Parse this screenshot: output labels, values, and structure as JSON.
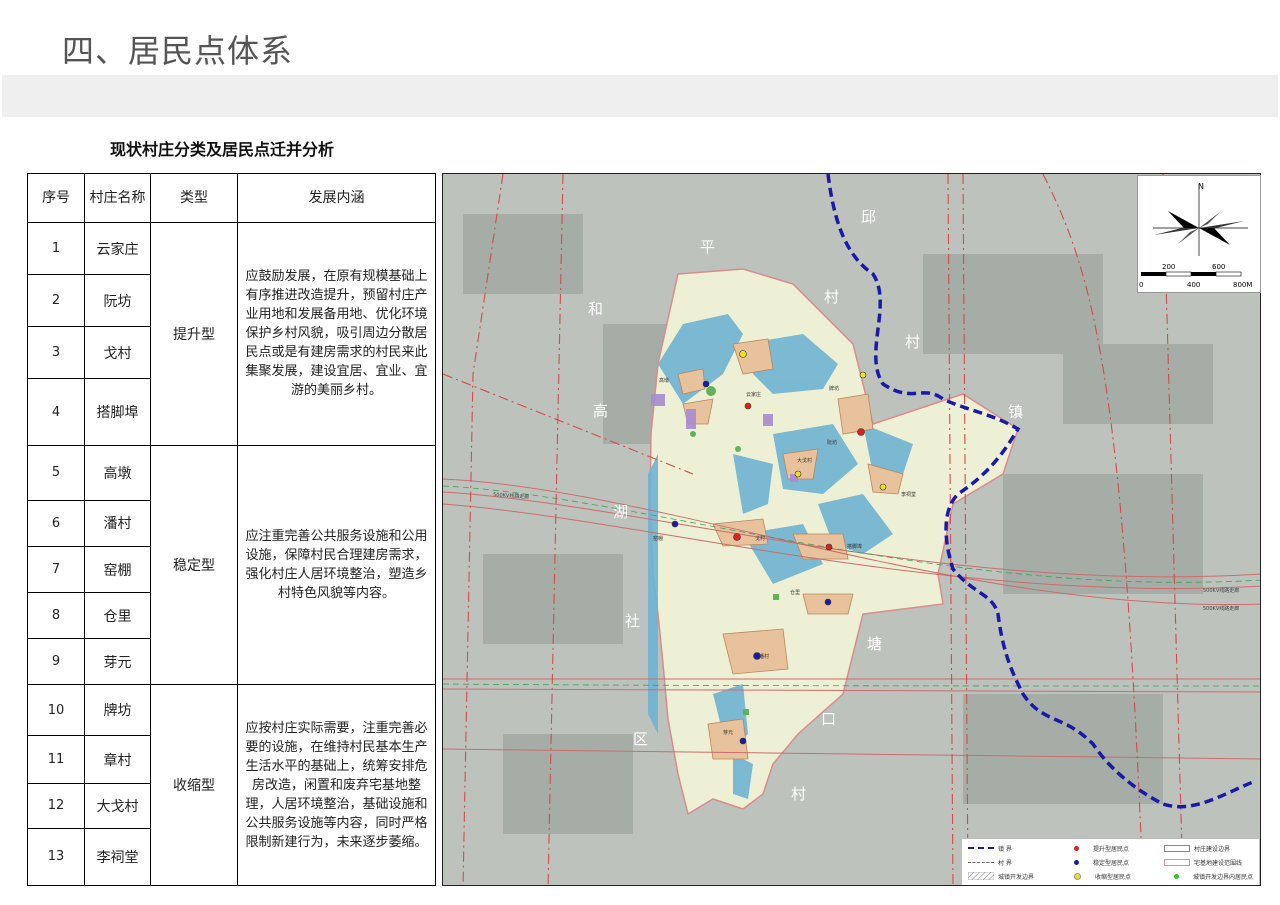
{
  "page": {
    "title": "四、居民点体系",
    "section_title": "现状村庄分类及居民点迁并分析"
  },
  "table": {
    "headers": [
      "序号",
      "村庄名称",
      "类型",
      "发展内涵"
    ],
    "groups": [
      {
        "type": "提升型",
        "description": "应鼓励发展，在原有规模基础上有序推进改造提升，预留村庄产业用地和发展备用地、优化环境保护乡村风貌，吸引周边分散居民点或是有建房需求的村民来此集聚发展，建设宜居、宜业、宜游的美丽乡村。",
        "rows": [
          {
            "num": "1",
            "name": "云家庄"
          },
          {
            "num": "2",
            "name": "阮坊"
          },
          {
            "num": "3",
            "name": "戈村"
          },
          {
            "num": "4",
            "name": "搭脚埠"
          }
        ]
      },
      {
        "type": "稳定型",
        "description": "应注重完善公共服务设施和公用设施，保障村民合理建房需求，强化村庄人居环境整治，塑造乡村特色风貌等内容。",
        "rows": [
          {
            "num": "5",
            "name": "高墩"
          },
          {
            "num": "6",
            "name": "潘村"
          },
          {
            "num": "7",
            "name": "窑棚"
          },
          {
            "num": "8",
            "name": "仓里"
          },
          {
            "num": "9",
            "name": "芽元"
          }
        ]
      },
      {
        "type": "收缩型",
        "description": "应按村庄实际需要，注重完善必要的设施，在维持村民基本生产生活水平的基础上，统筹安排危房改造，闲置和废弃宅基地整理，人居环境整治，基础设施和公共服务设施等内容，同时严格限制新建行为，未来逐步萎缩。",
        "rows": [
          {
            "num": "10",
            "name": "牌坊"
          },
          {
            "num": "11",
            "name": "章村"
          },
          {
            "num": "12",
            "name": "大戈村"
          },
          {
            "num": "13",
            "name": "李祠堂"
          }
        ]
      }
    ]
  },
  "map": {
    "compass_label": "N",
    "scale_top": [
      "200",
      "600"
    ],
    "scale_bottom": [
      "0",
      "400",
      "800M"
    ],
    "region_labels": [
      "邱",
      "平",
      "和",
      "高",
      "湖",
      "社",
      "区",
      "村",
      "村",
      "镇",
      "塘",
      "口",
      "村"
    ],
    "village_labels": [
      "高墩",
      "云家庄",
      "牌坊",
      "阮坊",
      "大戈村",
      "李祠堂",
      "窑棚",
      "戈村",
      "搭脚埠",
      "仓里",
      "潘村",
      "芽元",
      "章村"
    ],
    "line_labels": [
      "500KV线路走廊",
      "500KV线路走廊",
      "500KV线路走廊"
    ],
    "legend": [
      {
        "label": "镇 界",
        "kind": "line",
        "color": "#1a1aa8"
      },
      {
        "label": "提升型居民点",
        "kind": "dot",
        "color": "#e02020"
      },
      {
        "label": "村庄建设边界",
        "kind": "box",
        "color": "#888888"
      },
      {
        "label": "村 界",
        "kind": "dash",
        "color": "#666666"
      },
      {
        "label": "稳定型居民点",
        "kind": "dot",
        "color": "#1a1aa8"
      },
      {
        "label": "宅基地建设范围线",
        "kind": "box",
        "color": "#e29090"
      },
      {
        "label": "城镇开发边界",
        "kind": "hatch",
        "color": "#777777"
      },
      {
        "label": "收缩型居民点",
        "kind": "dot",
        "color": "#f2e020"
      },
      {
        "label": "城镇开发边界内居民点",
        "kind": "dot",
        "color": "#28c828"
      }
    ]
  }
}
